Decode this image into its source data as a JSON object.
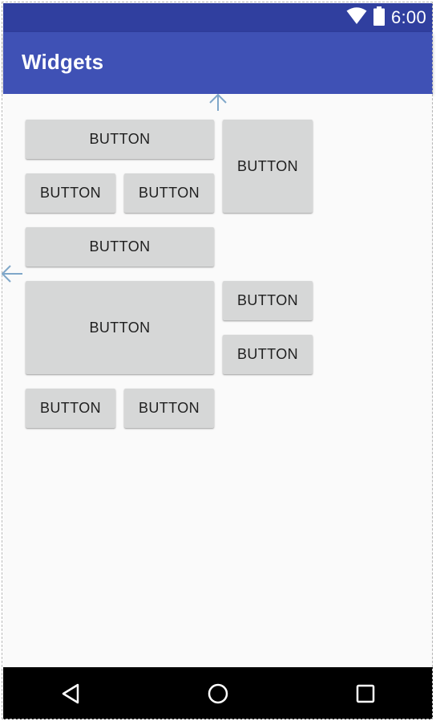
{
  "status_bar": {
    "time": "6:00",
    "icons": [
      "wifi-icon",
      "battery-icon"
    ],
    "color": "#303f9f"
  },
  "app_bar": {
    "title": "Widgets",
    "color": "#3f51b5"
  },
  "buttons": [
    "BUTTON",
    "BUTTON",
    "BUTTON",
    "BUTTON",
    "BUTTON",
    "BUTTON",
    "BUTTON",
    "BUTTON",
    "BUTTON",
    "BUTTON"
  ],
  "guides": {
    "icons": [
      "arrow-up-icon",
      "arrow-left-icon"
    ],
    "color": "#7fa7c9"
  },
  "nav_bar": {
    "icons": [
      "back-icon",
      "home-icon",
      "recents-icon"
    ]
  }
}
